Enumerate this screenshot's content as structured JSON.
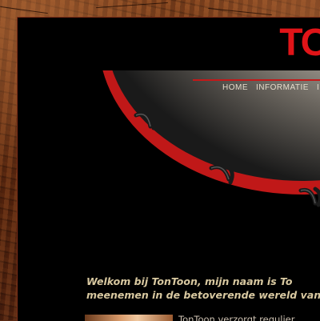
{
  "logo": {
    "text": "TO"
  },
  "nav": {
    "items": [
      "HOME",
      "INFORMATIE",
      "I"
    ]
  },
  "welcome": {
    "line1": "Welkom bij TonToon, mijn naam is To",
    "line2": "meenemen in de betoverende wereld van"
  },
  "intro": {
    "text": "TonToon verzorgt regulier"
  },
  "colors": {
    "accent": "#e01418",
    "nav_text": "#e6dccc",
    "welcome_text": "#d8c8a0",
    "background": "#000000"
  }
}
